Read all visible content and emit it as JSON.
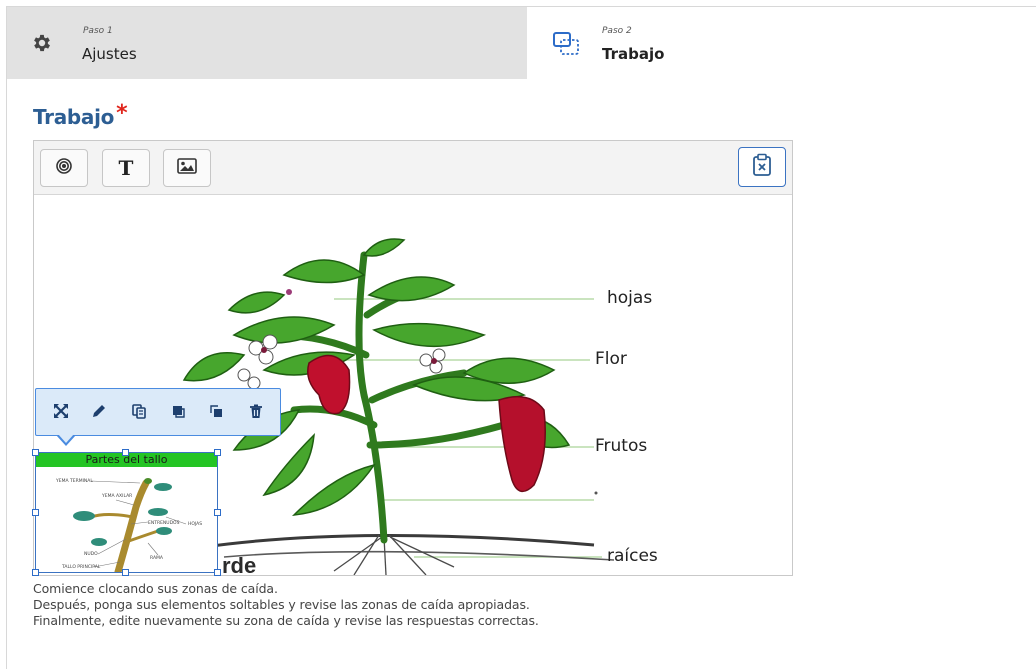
{
  "steps": [
    {
      "small": "Paso 1",
      "name": "Ajustes",
      "icon": "gear-icon",
      "active": false
    },
    {
      "small": "Paso 2",
      "name": "Trabajo",
      "icon": "dropzone-icon",
      "active": true
    }
  ],
  "section": {
    "title": "Trabajo",
    "required_mark": "*"
  },
  "toolbar": {
    "buttons": [
      {
        "icon": "target-icon"
      },
      {
        "icon": "text-icon",
        "glyph": "T"
      },
      {
        "icon": "image-icon"
      }
    ],
    "clipboard_icon": "clipboard-delete-icon"
  },
  "canvas": {
    "labels": [
      "hojas",
      "Flor",
      "Frutos",
      "raíces"
    ],
    "watermark": "rde"
  },
  "element_toolbar": {
    "icons": [
      "expand-icon",
      "edit-icon",
      "copy-icon",
      "bring-front-icon",
      "send-back-icon",
      "delete-icon"
    ]
  },
  "dropzone": {
    "title": "Partes del tallo",
    "diagram_labels": [
      "YEMA TERMINAL",
      "YEMA AXILAR",
      "ENTRENUDOS",
      "HOJAS",
      "NUDO",
      "TALLO PRINCIPAL",
      "RAMA"
    ]
  },
  "help": {
    "line1": "Comience clocando sus zonas de caída.",
    "line2": "Después, ponga sus elementos soltables y revise las zonas de caída apropiadas.",
    "line3": "Finalmente, edite nuevamente su zona de caída y revise las respuestas correctas."
  },
  "colors": {
    "accent": "#2d5e93",
    "required": "#e0261d",
    "selection": "#4a8be0",
    "dz_header": "#24c424"
  }
}
